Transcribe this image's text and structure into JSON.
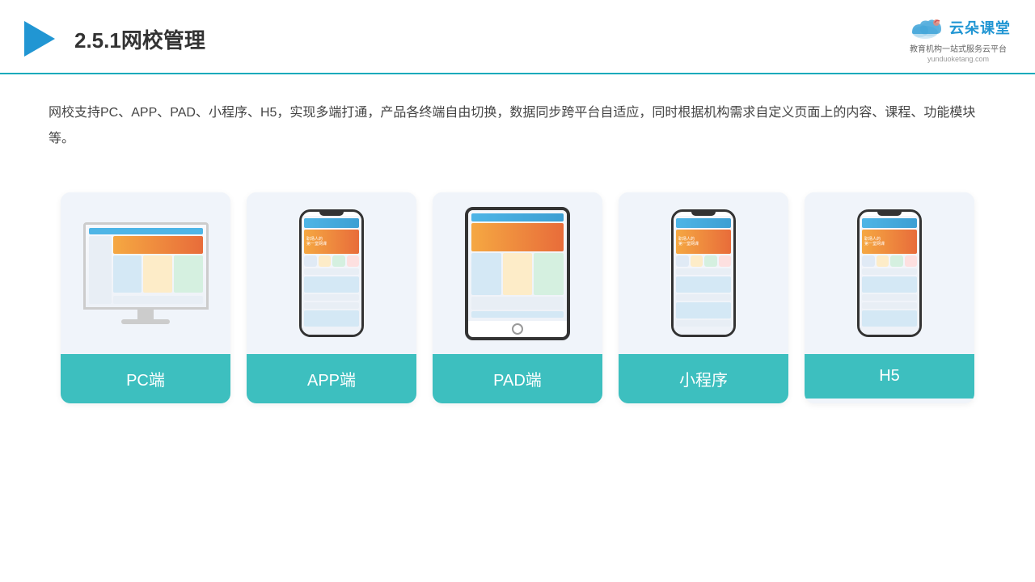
{
  "header": {
    "title_prefix": "2.5.1",
    "title_main": "网校管理",
    "logo_main": "云朵课堂",
    "logo_url": "yunduoketang.com",
    "logo_tagline": "教育机构一站式服务云平台"
  },
  "description": {
    "text": "网校支持PC、APP、PAD、小程序、H5，实现多端打通，产品各终端自由切换，数据同步跨平台自适应，同时根据机构需求自定义页面上的内容、课程、功能模块等。"
  },
  "cards": [
    {
      "label": "PC端",
      "type": "pc"
    },
    {
      "label": "APP端",
      "type": "phone"
    },
    {
      "label": "PAD端",
      "type": "tablet"
    },
    {
      "label": "小程序",
      "type": "phone"
    },
    {
      "label": "H5",
      "type": "phone"
    }
  ]
}
